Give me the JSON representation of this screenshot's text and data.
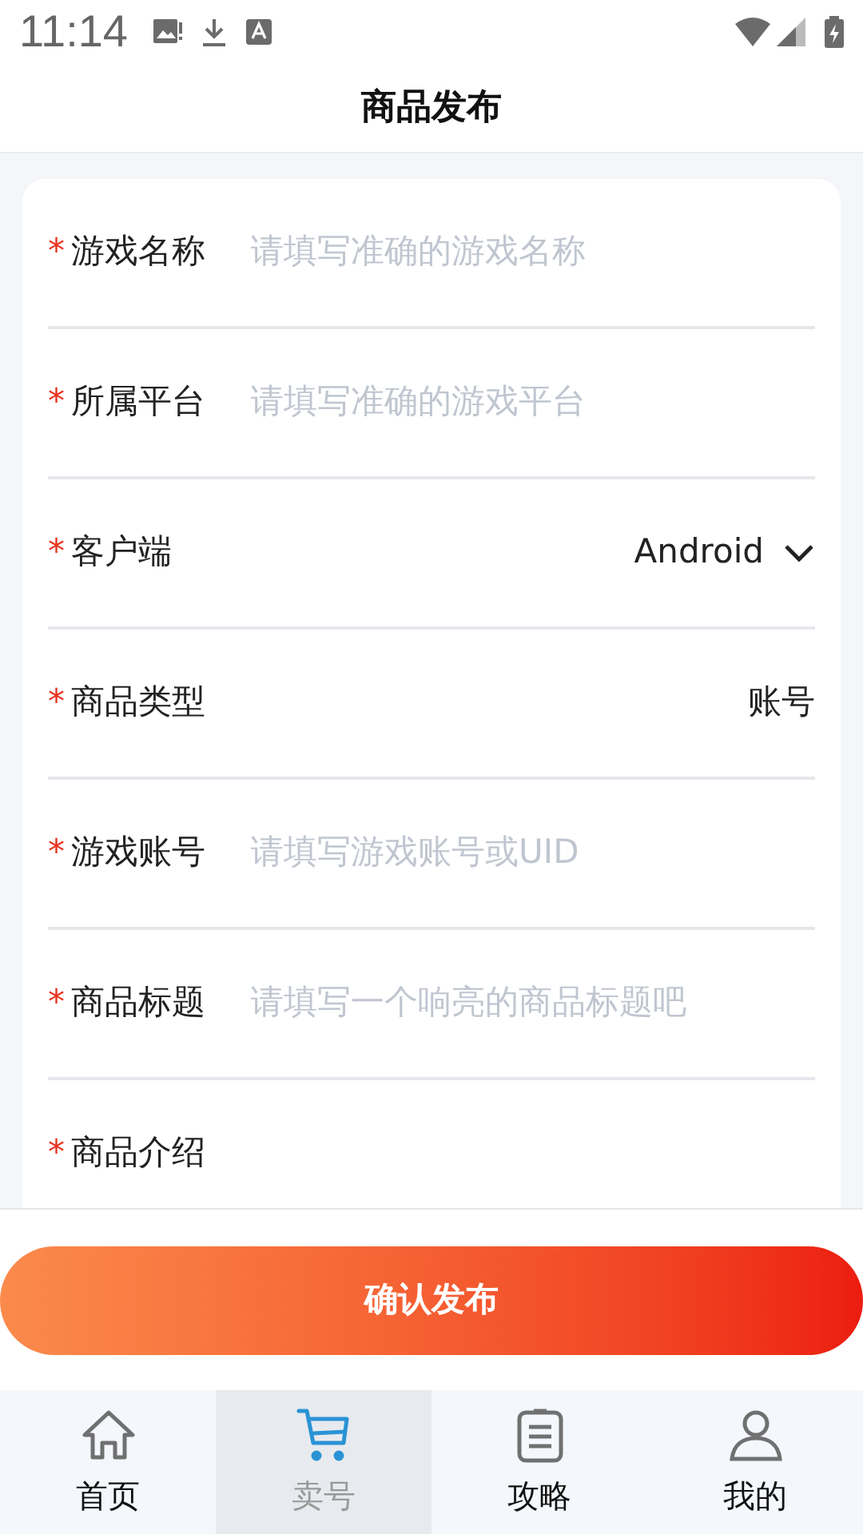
{
  "status_bar": {
    "time": "11:14"
  },
  "header": {
    "title": "商品发布"
  },
  "form": {
    "fields": [
      {
        "kind": "input",
        "required_mark": "*",
        "label": "游戏名称",
        "placeholder": "请填写准确的游戏名称"
      },
      {
        "kind": "input",
        "required_mark": "*",
        "label": "所属平台",
        "placeholder": "请填写准确的游戏平台"
      },
      {
        "kind": "select",
        "required_mark": "*",
        "label": "客户端",
        "value": "Android"
      },
      {
        "kind": "text",
        "required_mark": "*",
        "label": "商品类型",
        "value": "账号"
      },
      {
        "kind": "input",
        "required_mark": "*",
        "label": "游戏账号",
        "placeholder": "请填写游戏账号或UID"
      },
      {
        "kind": "input",
        "required_mark": "*",
        "label": "商品标题",
        "placeholder": "请填写一个响亮的商品标题吧"
      },
      {
        "kind": "label",
        "required_mark": "*",
        "label": "商品介绍"
      }
    ]
  },
  "submit_button": "确认发布",
  "tab_bar": [
    {
      "label": "首页",
      "selected": false
    },
    {
      "label": "卖号",
      "selected": true
    },
    {
      "label": "攻略",
      "selected": false
    },
    {
      "label": "我的",
      "selected": false
    }
  ]
}
